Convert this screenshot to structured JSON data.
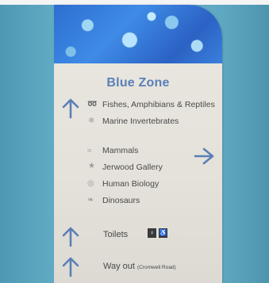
{
  "sign": {
    "title": "Blue Zone",
    "items": [
      {
        "label": "Fishes, Amphibians & Reptiles",
        "icon": "lizard-icon"
      },
      {
        "label": "Marine Invertebrates",
        "icon": "crab-icon"
      },
      {
        "label": "Mammals",
        "icon": "mammal-icon"
      },
      {
        "label": "Jerwood Gallery",
        "icon": "star-icon"
      },
      {
        "label": "Human Biology",
        "icon": "eye-icon"
      },
      {
        "label": "Dinosaurs",
        "icon": "dinosaur-icon"
      }
    ],
    "toilets": "Toilets",
    "way_out": "Way out",
    "way_out_note": "(Cromwell Road)"
  },
  "colors": {
    "wall": "#6cb3cb",
    "sign_panel": "#e9e7df",
    "arrow": "#5b7fb8",
    "banner": "#3f8be6"
  }
}
